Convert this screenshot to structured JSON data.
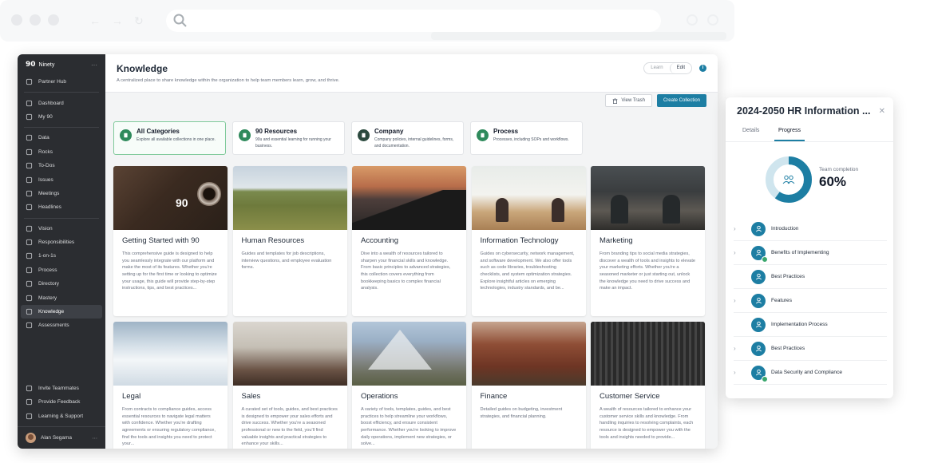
{
  "sidebar": {
    "brand": "Ninety",
    "items_top": [
      {
        "label": "Partner Hub",
        "icon": "people-icon"
      }
    ],
    "items_group1": [
      {
        "label": "Dashboard",
        "icon": "grid-icon"
      },
      {
        "label": "My 90",
        "icon": "target-icon"
      }
    ],
    "items_group2": [
      {
        "label": "Data",
        "icon": "chart-icon"
      },
      {
        "label": "Rocks",
        "icon": "rocks-icon"
      },
      {
        "label": "To-Dos",
        "icon": "checkbox-icon"
      },
      {
        "label": "Issues",
        "icon": "issue-icon"
      },
      {
        "label": "Meetings",
        "icon": "meeting-icon"
      },
      {
        "label": "Headlines",
        "icon": "headline-icon"
      }
    ],
    "items_group3": [
      {
        "label": "Vision",
        "icon": "binoculars-icon"
      },
      {
        "label": "Responsibilities",
        "icon": "org-icon"
      },
      {
        "label": "1-on-1s",
        "icon": "chat-icon"
      },
      {
        "label": "Process",
        "icon": "process-icon"
      },
      {
        "label": "Directory",
        "icon": "directory-icon"
      },
      {
        "label": "Mastery",
        "icon": "mastery-icon"
      },
      {
        "label": "Knowledge",
        "icon": "knowledge-icon",
        "active": true
      },
      {
        "label": "Assessments",
        "icon": "assessment-icon"
      }
    ],
    "items_bottom": [
      {
        "label": "Invite Teammates",
        "icon": "invite-icon"
      },
      {
        "label": "Provide Feedback",
        "icon": "feedback-icon"
      },
      {
        "label": "Learning & Support",
        "icon": "help-icon"
      }
    ],
    "user_name": "Alan Segama"
  },
  "header": {
    "title": "Knowledge",
    "subtitle": "A centralized place to share knowledge within the organization to help team members learn, grow, and thrive.",
    "toggle_learn": "Learn",
    "toggle_edit": "Edit",
    "view_trash": "View Trash",
    "create_collection": "Create Collection"
  },
  "categories": [
    {
      "title": "All Categories",
      "desc": "Explore all available collections in one place."
    },
    {
      "title": "90 Resources",
      "desc": "90u and essential learning for running your business."
    },
    {
      "title": "Company",
      "desc": "Company policies, internal guidelines, forms, and documentation."
    },
    {
      "title": "Process",
      "desc": "Processes, including SOPs and workflows."
    }
  ],
  "collections": [
    {
      "title": "Getting Started with 90",
      "desc": "This comprehensive guide is designed to help you seamlessly integrate with our platform and make the most of its features. Whether you're setting up for the first time or looking to optimize your usage, this guide will provide step-by-step instructions, tips, and best practices..."
    },
    {
      "title": "Human Resources",
      "desc": "Guides and templates for job descriptions, interview questions, and employee evaluation forms."
    },
    {
      "title": "Accounting",
      "desc": "Dive into a wealth of resources tailored to sharpen your financial skills and knowledge. From basic principles to advanced strategies, this collection covers everything from bookkeeping basics to complex financial analysis."
    },
    {
      "title": "Information Technology",
      "desc": "Guides on cybersecurity, network management, and software development. We also offer tools such as code libraries, troubleshooting checklists, and system optimization strategies. Explore insightful articles on emerging technologies, industry standards, and be..."
    },
    {
      "title": "Marketing",
      "desc": "From branding tips to social media strategies, discover a wealth of tools and insights to elevate your marketing efforts. Whether you're a seasoned marketer or just starting out, unlock the knowledge you need to drive success and make an impact."
    },
    {
      "title": "Legal",
      "desc": "From contracts to compliance guides, access essential resources to navigate legal matters with confidence. Whether you're drafting agreements or ensuring regulatory compliance, find the tools and insights you need to protect your..."
    },
    {
      "title": "Sales",
      "desc": "A curated set of tools, guides, and best practices is designed to empower your sales efforts and drive success. Whether you're a seasoned professional or new to the field, you'll find valuable insights and practical strategies to enhance your skills..."
    },
    {
      "title": "Operations",
      "desc": "A variety of tools, templates, guides, and best practices to help streamline your workflows, boost efficiency, and ensure consistent performance. Whether you're looking to improve daily operations, implement new strategies, or solve..."
    },
    {
      "title": "Finance",
      "desc": "Detailed guides on budgeting, investment strategies, and financial planning."
    },
    {
      "title": "Customer Service",
      "desc": "A wealth of resources tailored to enhance your customer service skills and knowledge. From handling inquiries to resolving complaints, each resource is designed to empower you with the tools and insights needed to provide..."
    }
  ],
  "panel": {
    "title": "2024-2050 HR Information ...",
    "tab_details": "Details",
    "tab_progress": "Progress",
    "completion_label": "Team completion",
    "completion_value": "60%",
    "completion_fraction": 0.6,
    "items": [
      {
        "label": "Introduction",
        "expandable": true,
        "done": false
      },
      {
        "label": "Benefits of Implementing",
        "expandable": true,
        "done": true
      },
      {
        "label": "Best Practices",
        "expandable": false,
        "done": false
      },
      {
        "label": "Features",
        "expandable": true,
        "done": false
      },
      {
        "label": "Implementation Process",
        "expandable": false,
        "done": false
      },
      {
        "label": "Best Practices",
        "expandable": true,
        "done": false
      },
      {
        "label": "Data Security and Compliance",
        "expandable": true,
        "done": true
      }
    ]
  },
  "colors": {
    "accent": "#1d7ea3",
    "sidebar_bg": "#2b2d31",
    "category_icon": "#2f8a5c",
    "success": "#3aa76d"
  }
}
